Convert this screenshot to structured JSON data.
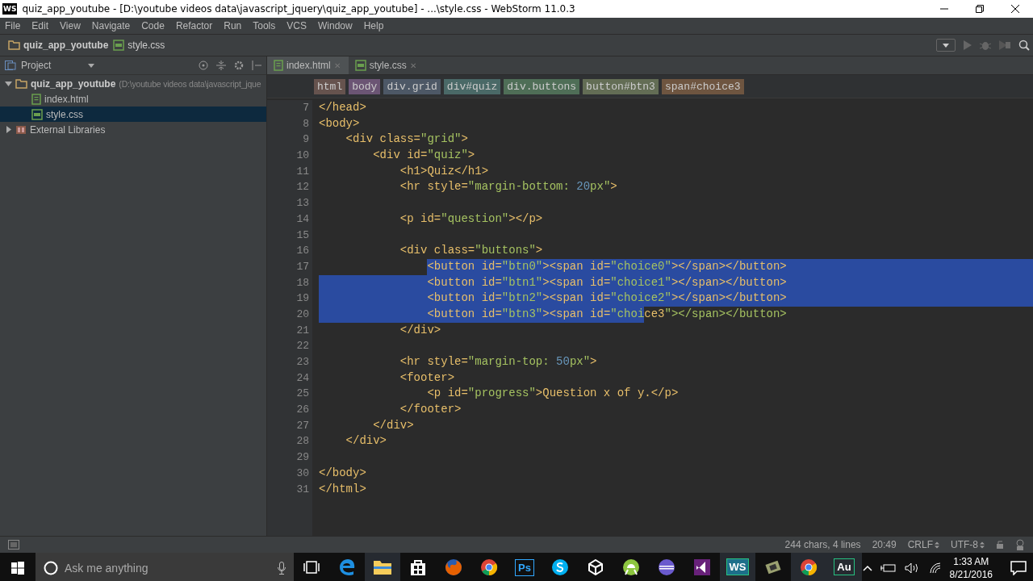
{
  "window": {
    "title": "quiz_app_youtube - [D:\\youtube videos data\\javascript_jquery\\quiz_app_youtube] - ...\\style.css - WebStorm 11.0.3",
    "app_badge": "WS"
  },
  "menu": [
    "File",
    "Edit",
    "View",
    "Navigate",
    "Code",
    "Refactor",
    "Run",
    "Tools",
    "VCS",
    "Window",
    "Help"
  ],
  "nav_bar": [
    "quiz_app_youtube",
    "style.css"
  ],
  "project_panel": {
    "title": "Project",
    "tree": [
      {
        "label": "quiz_app_youtube",
        "hint": "(D:\\youtube videos data\\javascript_jque",
        "kind": "folder",
        "expanded": true,
        "selected": false,
        "children": [
          {
            "label": "index.html",
            "kind": "html",
            "selected": false
          },
          {
            "label": "style.css",
            "kind": "css",
            "selected": true
          }
        ]
      },
      {
        "label": "External Libraries",
        "kind": "library",
        "expanded": false,
        "selected": false
      }
    ]
  },
  "tabs": [
    {
      "label": "index.html",
      "kind": "html",
      "selected": true,
      "close": "✕"
    },
    {
      "label": "style.css",
      "kind": "css",
      "selected": false,
      "close": "✕"
    }
  ],
  "breadcrumbs": [
    {
      "label": "html",
      "color": "#66534e"
    },
    {
      "label": "body",
      "color": "#6b5574"
    },
    {
      "label": "div.grid",
      "color": "#4d5866"
    },
    {
      "label": "div#quiz",
      "color": "#4a6967"
    },
    {
      "label": "div.buttons",
      "color": "#4f6e57"
    },
    {
      "label": "button#btn3",
      "color": "#636d55"
    },
    {
      "label": "span#choice3",
      "color": "#6e5540"
    }
  ],
  "editor": {
    "lines": [
      {
        "number": "7",
        "segments": [
          {
            "text": "</head>",
            "selected": false
          }
        ]
      },
      {
        "number": "8",
        "segments": [
          {
            "text": "<body>",
            "selected": false
          }
        ]
      },
      {
        "number": "9",
        "segments": [
          {
            "text": "    <div class=\"grid\">",
            "selected": false
          }
        ]
      },
      {
        "number": "10",
        "segments": [
          {
            "text": "        <div id=\"quiz\">",
            "selected": false
          }
        ]
      },
      {
        "number": "11",
        "segments": [
          {
            "text": "            <h1>Quiz</h1>",
            "selected": false
          }
        ]
      },
      {
        "number": "12",
        "segments": [
          {
            "text": "            <hr style=\"margin-bottom: 20px\">",
            "selected": false
          }
        ]
      },
      {
        "number": "13"
      },
      {
        "number": "14",
        "segments": [
          {
            "text": "            <p id=\"question\"></p>",
            "selected": false
          }
        ]
      },
      {
        "number": "15"
      },
      {
        "number": "16",
        "segments": [
          {
            "text": "            <div class=\"buttons\">",
            "selected": false
          }
        ]
      },
      {
        "number": "17",
        "segments": [
          {
            "text": "                <button id=\"btn0\"><span id=\"choice0\"></span></button>",
            "selected": true
          }
        ]
      },
      {
        "number": "18",
        "segments": [
          {
            "text": "                <button id=\"btn1\"><span id=\"choice1\"></span></button>",
            "selected": true
          }
        ]
      },
      {
        "number": "19",
        "segments": [
          {
            "text": "                <button id=\"btn2\"><span id=\"choice2\"></span></button>",
            "selected": true
          }
        ]
      },
      {
        "number": "20",
        "segments": [
          {
            "text": "                <button id=\"btn3\"><span id=\"choi",
            "selected": true
          },
          {
            "text": "ce3\"></span></button>",
            "selected": false
          }
        ]
      },
      {
        "number": "21",
        "segments": [
          {
            "text": "            </div>",
            "selected": false
          }
        ]
      },
      {
        "number": "22"
      },
      {
        "number": "23",
        "segments": [
          {
            "text": "            <hr style=\"margin-top: 50px\">",
            "selected": false
          }
        ]
      },
      {
        "number": "24",
        "segments": [
          {
            "text": "            <footer>",
            "selected": false
          }
        ]
      },
      {
        "number": "25",
        "segments": [
          {
            "text": "                <p id=\"progress\">Question x of y.</p>",
            "selected": false
          }
        ]
      },
      {
        "number": "26",
        "segments": [
          {
            "text": "            </footer>",
            "selected": false
          }
        ]
      },
      {
        "number": "27",
        "segments": [
          {
            "text": "        </div>",
            "selected": false
          }
        ]
      },
      {
        "number": "28",
        "segments": [
          {
            "text": "    </div>",
            "selected": false
          }
        ]
      },
      {
        "number": "29"
      },
      {
        "number": "30",
        "segments": [
          {
            "text": "</body>",
            "selected": false
          }
        ]
      },
      {
        "number": "31",
        "segments": [
          {
            "text": "</html>",
            "selected": false
          }
        ]
      }
    ]
  },
  "status_bar": {
    "selection_info": "244 chars, 4 lines",
    "position": "20:49",
    "line_separator": "CRLF",
    "encoding": "UTF-8"
  },
  "taskbar": {
    "search_placeholder": "Ask me anything",
    "apps": [
      {
        "kind": "edge",
        "running": false
      },
      {
        "kind": "folder",
        "running": true
      },
      {
        "kind": "store",
        "running": false
      },
      {
        "kind": "firefox",
        "running": false
      },
      {
        "kind": "chrome",
        "running": false
      },
      {
        "kind": "letters",
        "label": "Ps",
        "running": false
      },
      {
        "kind": "skype",
        "running": false
      },
      {
        "kind": "unity",
        "running": false
      },
      {
        "kind": "android",
        "running": false
      },
      {
        "kind": "eclipse",
        "running": false
      },
      {
        "kind": "vs",
        "running": false
      },
      {
        "kind": "letters",
        "label": "WS",
        "running": true
      },
      {
        "kind": "film",
        "running": false
      },
      {
        "kind": "chrome",
        "running": true
      },
      {
        "kind": "letters",
        "label": "Au",
        "running": true
      }
    ],
    "time": "1:33 AM",
    "date": "8/21/2016"
  }
}
